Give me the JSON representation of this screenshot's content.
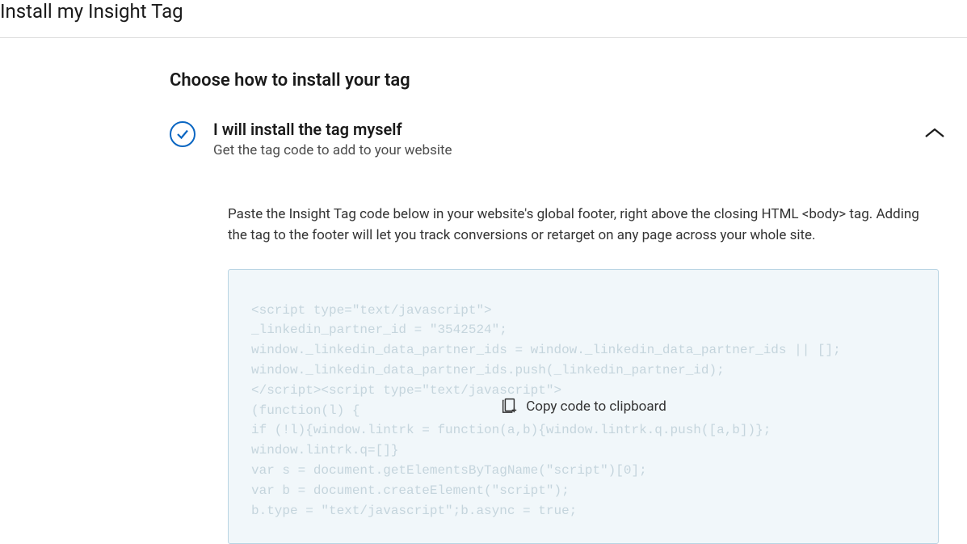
{
  "header": {
    "title": "Install my Insight Tag"
  },
  "section": {
    "title": "Choose how to install your tag"
  },
  "option": {
    "title": "I will install the tag myself",
    "subtitle": "Get the tag code to add to your website"
  },
  "description": "Paste the Insight Tag code below in your website's global footer, right above the closing HTML <body> tag. Adding the tag to the footer will let you track conversions or retarget on any page across your whole site.",
  "code": "<script type=\"text/javascript\">\n_linkedin_partner_id = \"3542524\";\nwindow._linkedin_data_partner_ids = window._linkedin_data_partner_ids || [];\nwindow._linkedin_data_partner_ids.push(_linkedin_partner_id);\n</script><script type=\"text/javascript\">\n(function(l) {\nif (!l){window.lintrk = function(a,b){window.lintrk.q.push([a,b])};\nwindow.lintrk.q=[]}\nvar s = document.getElementsByTagName(\"script\")[0];\nvar b = document.createElement(\"script\");\nb.type = \"text/javascript\";b.async = true;",
  "copy": {
    "label": "Copy code to clipboard"
  }
}
